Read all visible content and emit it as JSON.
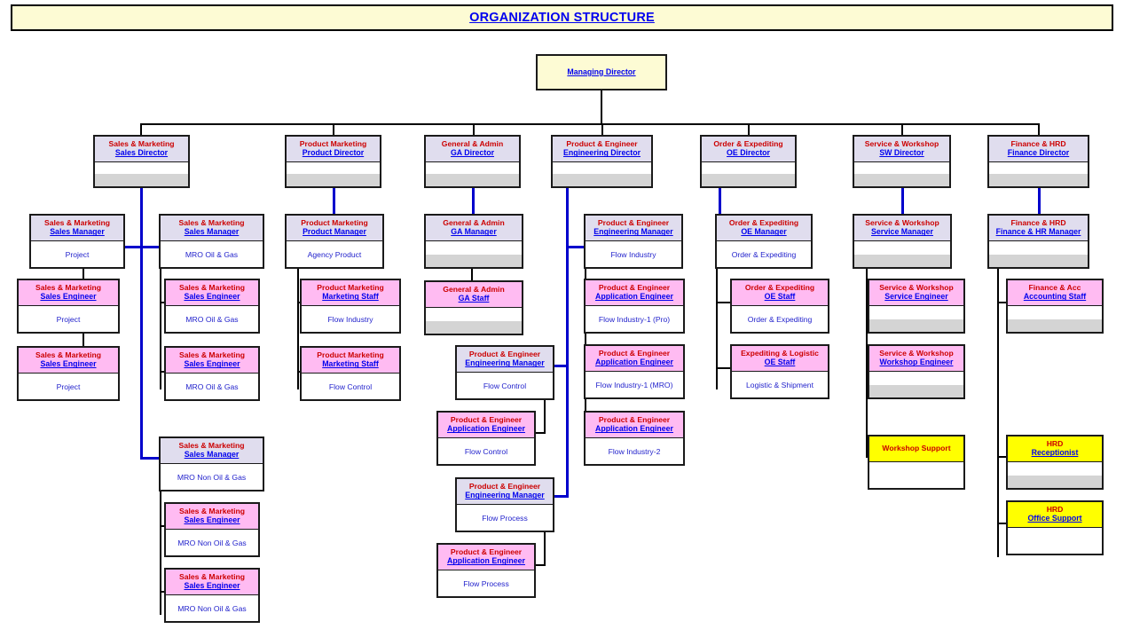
{
  "title": {
    "text": "ORGANIZATION STRUCTURE"
  },
  "root": {
    "role": "Managing Director"
  },
  "directors": [
    {
      "dept": "Sales & Marketing",
      "role": "Sales Director"
    },
    {
      "dept": "Product Marketing",
      "role": "Product Director"
    },
    {
      "dept": "General & Admin",
      "role": "GA Director"
    },
    {
      "dept": "Product & Engineer",
      "role": "Engineering Director"
    },
    {
      "dept": "Order & Expediting",
      "role": "OE Director"
    },
    {
      "dept": "Service & Workshop",
      "role": "SW Director"
    },
    {
      "dept": "Finance & HRD",
      "role": "Finance Director"
    }
  ],
  "sales_column": {
    "manager_project": {
      "dept": "Sales & Marketing",
      "role": "Sales Manager",
      "detail": "Project"
    },
    "manager_mro_oil": {
      "dept": "Sales & Marketing",
      "role": "Sales Manager",
      "detail": "MRO Oil & Gas"
    },
    "manager_mro_nonoil": {
      "dept": "Sales & Marketing",
      "role": "Sales Manager",
      "detail": "MRO Non Oil & Gas"
    },
    "engineers_project": [
      {
        "dept": "Sales & Marketing",
        "role": "Sales Engineer",
        "detail": "Project"
      },
      {
        "dept": "Sales & Marketing",
        "role": "Sales Engineer",
        "detail": "Project"
      }
    ],
    "engineers_mro_oil": [
      {
        "dept": "Sales & Marketing",
        "role": "Sales Engineer",
        "detail": "MRO Oil & Gas"
      },
      {
        "dept": "Sales & Marketing",
        "role": "Sales Engineer",
        "detail": "MRO Oil & Gas"
      }
    ],
    "engineers_mro_nonoil": [
      {
        "dept": "Sales & Marketing",
        "role": "Sales Engineer",
        "detail": "MRO Non Oil & Gas"
      },
      {
        "dept": "Sales & Marketing",
        "role": "Sales Engineer",
        "detail": "MRO Non Oil & Gas"
      }
    ]
  },
  "product_marketing_column": {
    "manager": {
      "dept": "Product Marketing",
      "role": "Product Manager",
      "detail": "Agency Product"
    },
    "staff": [
      {
        "dept": "Product Marketing",
        "role": "Marketing Staff",
        "detail": "Flow Industry"
      },
      {
        "dept": "Product Marketing",
        "role": "Marketing Staff",
        "detail": "Flow Control"
      }
    ]
  },
  "ga_column": {
    "manager": {
      "dept": "General & Admin",
      "role": "GA Manager",
      "detail": ""
    },
    "staff": [
      {
        "dept": "General & Admin",
        "role": "GA Staff",
        "detail": ""
      }
    ],
    "engineering_managers": [
      {
        "dept": "Product & Engineer",
        "role": "Engineering Manager",
        "detail": "Flow Control"
      },
      {
        "dept": "Product & Engineer",
        "role": "Engineering Manager",
        "detail": "Flow Process"
      }
    ],
    "application_engineers": [
      {
        "dept": "Product & Engineer",
        "role": "Application Engineer",
        "detail": "Flow Control"
      },
      {
        "dept": "Product & Engineer",
        "role": "Application Engineer",
        "detail": "Flow Process"
      }
    ]
  },
  "engineering_column": {
    "manager": {
      "dept": "Product & Engineer",
      "role": "Engineering Manager",
      "detail": "Flow Industry"
    },
    "application_engineers": [
      {
        "dept": "Product & Engineer",
        "role": "Application Engineer",
        "detail": "Flow Industry-1 (Pro)"
      },
      {
        "dept": "Product & Engineer",
        "role": "Application Engineer",
        "detail": "Flow Industry-1 (MRO)"
      },
      {
        "dept": "Product & Engineer",
        "role": "Application Engineer",
        "detail": "Flow Industry-2"
      }
    ]
  },
  "oe_column": {
    "manager": {
      "dept": "Order & Expediting",
      "role": "OE Manager",
      "detail": "Order & Expediting"
    },
    "staff": [
      {
        "dept": "Order & Expediting",
        "role": "OE Staff",
        "detail": "Order & Expediting"
      },
      {
        "dept": "Expediting & Logistic",
        "role": "OE Staff",
        "detail": "Logistic & Shipment"
      }
    ]
  },
  "service_column": {
    "manager": {
      "dept": "Service & Workshop",
      "role": "Service Manager",
      "detail": ""
    },
    "staff": [
      {
        "dept": "Service & Workshop",
        "role": "Service Engineer",
        "detail": ""
      },
      {
        "dept": "Service & Workshop",
        "role": "Workshop Engineer",
        "detail": ""
      }
    ],
    "support": {
      "dept": "Workshop Support",
      "role": "",
      "detail": ""
    }
  },
  "finance_column": {
    "manager": {
      "dept": "Finance & HRD",
      "role": "Finance & HR Manager",
      "detail": ""
    },
    "staff": [
      {
        "dept": "Finance & Acc",
        "role": "Accounting Staff",
        "detail": ""
      }
    ],
    "hrd": [
      {
        "dept": "HRD",
        "role": "Receptionist",
        "detail": ""
      },
      {
        "dept": "HRD",
        "role": "Office Support",
        "detail": ""
      }
    ]
  }
}
